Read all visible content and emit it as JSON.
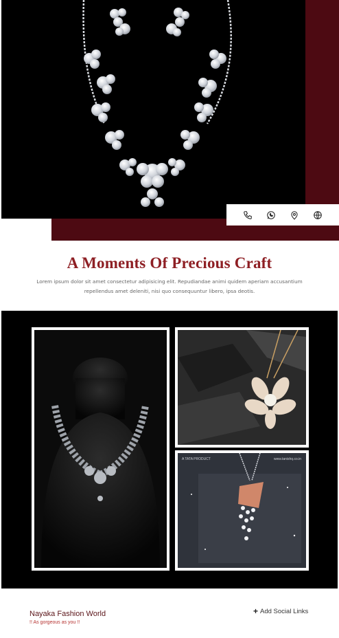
{
  "hero": {
    "image_alt": "Silver leaf necklace set with earrings",
    "contact_icons": [
      "phone-icon",
      "whatsapp-icon",
      "location-icon",
      "globe-icon"
    ]
  },
  "intro": {
    "title": "A Moments Of Precious Craft",
    "description": "Lorem ipsum dolor sit amet consectetur adipisicing elit. Repudiandae animi quidem aperiam accusantium repellendus amet deleniti, nisi quo consequuntur libero, ipsa deotis."
  },
  "gallery": {
    "tile3_brand": "A TATA PRODUCT",
    "tile3_url": "www.tanishq.co.in"
  },
  "footer": {
    "brand_name": "Nayaka Fashion World",
    "tagline": "!! As gorgeous as you !!",
    "add_social_label": "Add Social Links"
  },
  "colors": {
    "accent": "#4d0a12",
    "title": "#8e1f24",
    "tagline": "#b5312f"
  }
}
